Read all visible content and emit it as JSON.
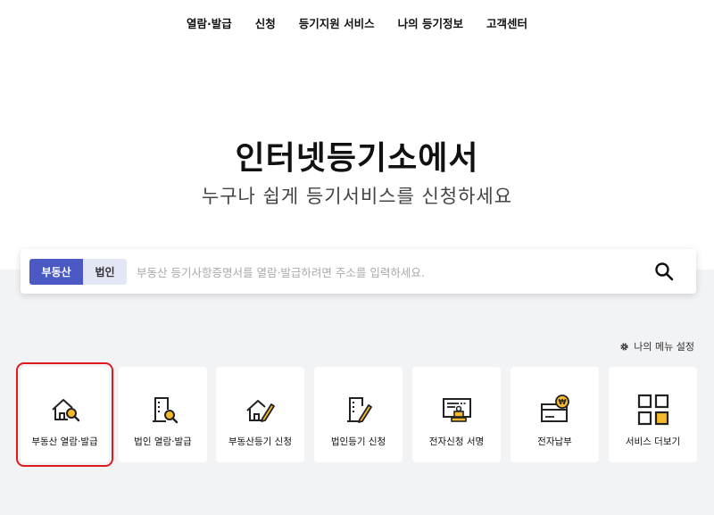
{
  "nav": {
    "items": [
      "열람·발급",
      "신청",
      "등기지원 서비스",
      "나의 등기정보",
      "고객센터"
    ]
  },
  "hero": {
    "title": "인터넷등기소에서",
    "subtitle": "누구나 쉽게 등기서비스를 신청하세요"
  },
  "search": {
    "tab_active": "부동산",
    "tab_inactive": "법인",
    "placeholder": "부동산 등기사항증명서를 열람·발급하려면 주소를 입력하세요.",
    "icon": "search-icon"
  },
  "menu_setting": {
    "label": "나의 메뉴 설정",
    "icon": "gear-icon"
  },
  "quick_menu": [
    {
      "label": "부동산 열람·발급",
      "icon": "house-search-icon",
      "selected": true
    },
    {
      "label": "법인 열람·발급",
      "icon": "building-search-icon",
      "selected": false
    },
    {
      "label": "부동산등기 신청",
      "icon": "house-pen-icon",
      "selected": false
    },
    {
      "label": "법인등기 신청",
      "icon": "building-pen-icon",
      "selected": false
    },
    {
      "label": "전자신청 서명",
      "icon": "e-signature-icon",
      "selected": false
    },
    {
      "label": "전자납부",
      "icon": "e-payment-icon",
      "selected": false
    },
    {
      "label": "서비스 더보기",
      "icon": "grid-more-icon",
      "selected": false
    }
  ],
  "colors": {
    "accent": "#4a59c4",
    "highlight_yellow": "#f5b92b",
    "selection_border": "#e0191f"
  }
}
